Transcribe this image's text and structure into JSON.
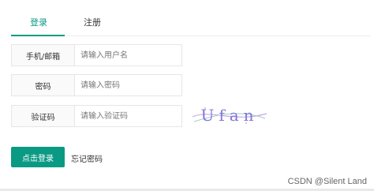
{
  "tabs": {
    "login": "登录",
    "register": "注册"
  },
  "form": {
    "account": {
      "label": "手机/邮箱",
      "placeholder": "请输入用户名",
      "value": ""
    },
    "password": {
      "label": "密码",
      "placeholder": "请输入密码",
      "value": ""
    },
    "captcha": {
      "label": "验证码",
      "placeholder": "请输入验证码",
      "value": "",
      "image_text": "Ufan"
    }
  },
  "actions": {
    "login_button": "点击登录",
    "forgot_password": "忘记密码"
  },
  "watermark": "CSDN @Silent Land",
  "colors": {
    "accent": "#0a9a83"
  }
}
